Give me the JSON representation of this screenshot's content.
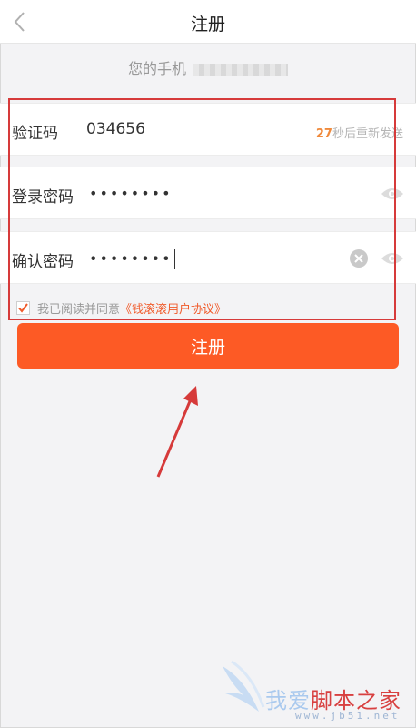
{
  "header": {
    "title": "注册",
    "back_icon": "chevron-left-icon"
  },
  "phone": {
    "label": "您的手机"
  },
  "form": {
    "code": {
      "label": "验证码",
      "value": "034656",
      "countdown_seconds": "27",
      "countdown_suffix": "秒后重新发送"
    },
    "password": {
      "label": "登录密码",
      "value": "••••••••"
    },
    "confirm": {
      "label": "确认密码",
      "value": "••••••••"
    }
  },
  "agreement": {
    "checked": true,
    "text": "我已阅读并同意",
    "link": "《钱滚滚用户协议》"
  },
  "register_button": {
    "label": "注册"
  },
  "watermark": {
    "text_a": "我爱",
    "text_b": "脚本之家",
    "url": "www.jb51.net"
  },
  "colors": {
    "accent": "#fd5a25",
    "highlight": "#d63a3a",
    "countdown_num": "#f08a3c",
    "link": "#f05a2a"
  }
}
